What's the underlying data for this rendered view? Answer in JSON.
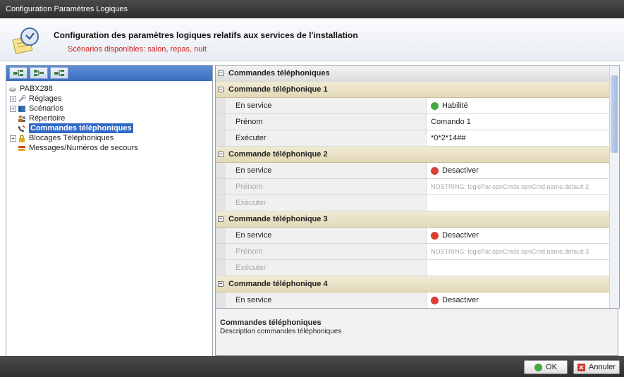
{
  "window": {
    "title": "Configuration Paramètres Logiques"
  },
  "header": {
    "title": "Configuration des paramètres logiques relatifs aux services de l'installation",
    "subtitle": "Scénarios disponibles: salon, repas, nuit"
  },
  "tree": {
    "root": "PABX288",
    "items": [
      {
        "label": "Réglages",
        "icon": "wrench-icon"
      },
      {
        "label": "Scénarios",
        "icon": "book-icon"
      },
      {
        "label": "Répertoire",
        "icon": "contacts-icon"
      },
      {
        "label": "Commandes téléphoniques",
        "icon": "phone-icon",
        "selected": true
      },
      {
        "label": "Blocages Téléphoniques",
        "icon": "lock-icon"
      },
      {
        "label": "Messages/Numéros de secours",
        "icon": "emergency-icon"
      }
    ]
  },
  "grid": {
    "root_label": "Commandes téléphoniques",
    "commands": [
      {
        "title": "Commande téléphonique 1",
        "rows": [
          {
            "name": "En service",
            "value": "Habilité",
            "status": "ok"
          },
          {
            "name": "Prénom",
            "value": "Comando 1"
          },
          {
            "name": "Exécuter",
            "value": "*0*2*14##"
          }
        ]
      },
      {
        "title": "Commande téléphonique 2",
        "rows": [
          {
            "name": "En service",
            "value": "Desactiver",
            "status": "no"
          },
          {
            "name": "Prénom",
            "value": "NOSTRING: logicPar.opnCmds.opnCmd.name.default 2",
            "disabled": true
          },
          {
            "name": "Exécuter",
            "value": "",
            "disabled": true
          }
        ]
      },
      {
        "title": "Commande téléphonique 3",
        "rows": [
          {
            "name": "En service",
            "value": "Desactiver",
            "status": "no"
          },
          {
            "name": "Prénom",
            "value": "NOSTRING: logicPar.opnCmds.opnCmd.name.default 3",
            "disabled": true
          },
          {
            "name": "Exécuter",
            "value": "",
            "disabled": true
          }
        ]
      },
      {
        "title": "Commande téléphonique 4",
        "rows": [
          {
            "name": "En service",
            "value": "Desactiver",
            "status": "no"
          }
        ]
      }
    ]
  },
  "description": {
    "title": "Commandes téléphoniques",
    "text": "Description commandes téléphoniques"
  },
  "footer": {
    "ok_label": "OK",
    "cancel_label": "Annuler"
  }
}
